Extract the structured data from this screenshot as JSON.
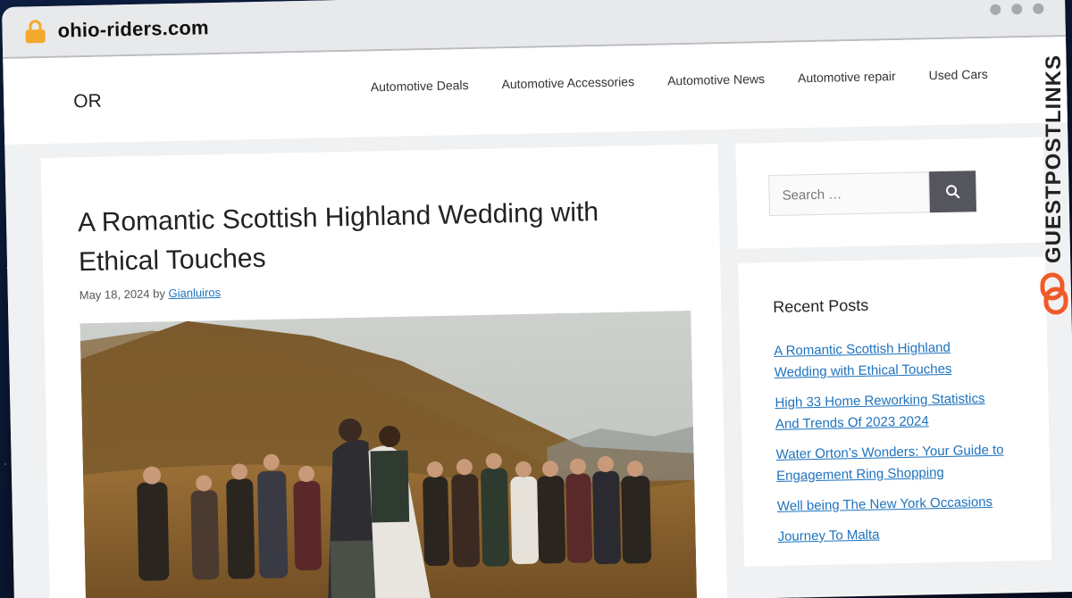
{
  "browser": {
    "url": "ohio-riders.com"
  },
  "site": {
    "logo": "OR",
    "nav": [
      {
        "label": "Automotive Deals"
      },
      {
        "label": "Automotive Accessories"
      },
      {
        "label": "Automotive News"
      },
      {
        "label": "Automotive repair"
      },
      {
        "label": "Used Cars"
      }
    ]
  },
  "article": {
    "title": "A Romantic Scottish Highland Wedding with Ethical Touches",
    "date": "May 18, 2024",
    "by": "by",
    "author": "Gianluiros"
  },
  "sidebar": {
    "search_placeholder": "Search …",
    "recent_title": "Recent Posts",
    "recent_posts": [
      "A Romantic Scottish Highland Wedding with Ethical Touches",
      "High 33 Home Reworking Statistics And Trends Of 2023 2024",
      "Water Orton’s Wonders: Your Guide to Engagement Ring Shopping",
      "Well being The New York Occasions",
      "Journey To Malta"
    ]
  },
  "watermark": {
    "text": "GUESTPOSTLINKS",
    "accent_color": "#f05a28"
  }
}
